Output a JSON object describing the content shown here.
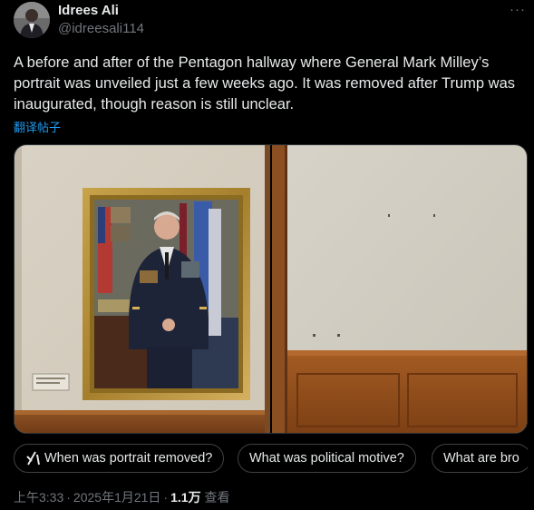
{
  "author": {
    "name": "Idrees Ali",
    "handle": "@idreesali114",
    "avatar": "avatar-photo"
  },
  "more_icon": "more-icon",
  "tweet": {
    "text": "A before and after of the Pentagon hallway where General Mark Milley’s portrait was unveiled just a few weeks ago. It was removed after Trump was inaugurated, though reason is still unclear.",
    "translate_label": "翻译帖子"
  },
  "media": {
    "photos": [
      {
        "name": "photo-before",
        "content": "framed portrait of General Mark Milley in hallway"
      },
      {
        "name": "photo-after",
        "content": "empty wall where portrait hung"
      }
    ]
  },
  "grok_prompts": [
    {
      "label": "When was portrait removed?",
      "icon": "grok-icon"
    },
    {
      "label": "What was political motive?"
    },
    {
      "label": "What are bro"
    }
  ],
  "meta": {
    "time": "上午3:33",
    "date": "2025年1月21日",
    "separator": "·",
    "views_count": "1.1万",
    "views_label": "查看"
  },
  "colors": {
    "background": "#000000",
    "text": "#e7e9ea",
    "secondary_text": "#71767b",
    "link": "#1d9bf0",
    "border": "#2f3336"
  }
}
